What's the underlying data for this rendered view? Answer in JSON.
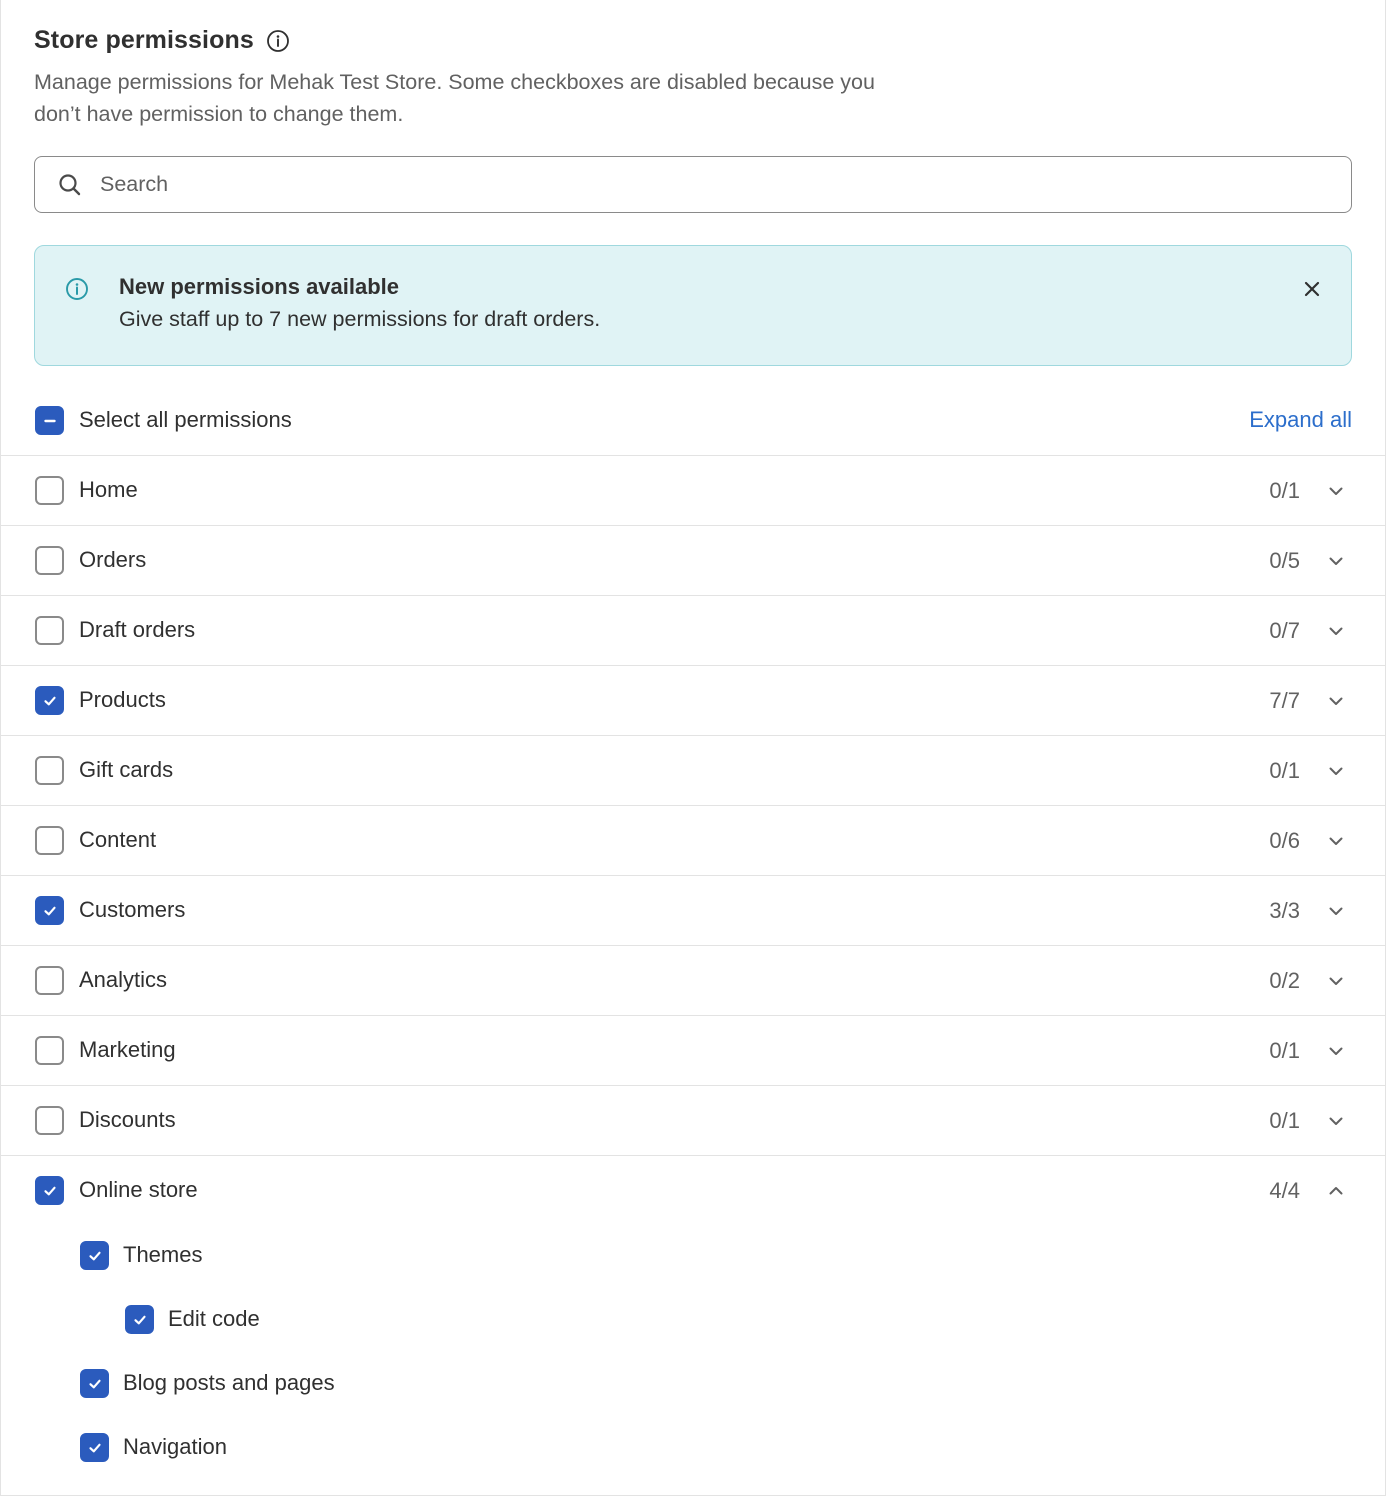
{
  "header": {
    "title": "Store permissions",
    "subtitle": "Manage permissions for Mehak Test Store. Some checkboxes are disabled because you don’t have permission to change them."
  },
  "search": {
    "placeholder": "Search",
    "value": ""
  },
  "banner": {
    "title": "New permissions available",
    "text": "Give staff up to 7 new permissions for draft orders."
  },
  "select_all": {
    "label": "Select all permissions",
    "state": "indeterminate",
    "expand_label": "Expand all"
  },
  "permissions": [
    {
      "label": "Home",
      "count": "0/1",
      "checked": false
    },
    {
      "label": "Orders",
      "count": "0/5",
      "checked": false
    },
    {
      "label": "Draft orders",
      "count": "0/7",
      "checked": false
    },
    {
      "label": "Products",
      "count": "7/7",
      "checked": true
    },
    {
      "label": "Gift cards",
      "count": "0/1",
      "checked": false
    },
    {
      "label": "Content",
      "count": "0/6",
      "checked": false
    },
    {
      "label": "Customers",
      "count": "3/3",
      "checked": true
    },
    {
      "label": "Analytics",
      "count": "0/2",
      "checked": false
    },
    {
      "label": "Marketing",
      "count": "0/1",
      "checked": false
    },
    {
      "label": "Discounts",
      "count": "0/1",
      "checked": false
    },
    {
      "label": "Online store",
      "count": "4/4",
      "checked": true,
      "expanded": true
    }
  ],
  "online_store_children": [
    {
      "label": "Themes",
      "checked": true,
      "level": 1
    },
    {
      "label": "Edit code",
      "checked": true,
      "level": 2
    },
    {
      "label": "Blog posts and pages",
      "checked": true,
      "level": 1
    },
    {
      "label": "Navigation",
      "checked": true,
      "level": 1
    }
  ],
  "colors": {
    "accent": "#2b5bbd",
    "link": "#2c6ecb",
    "banner_bg": "#e0f3f5",
    "banner_border": "#9fd8de",
    "text": "#303030",
    "muted": "#616161"
  }
}
